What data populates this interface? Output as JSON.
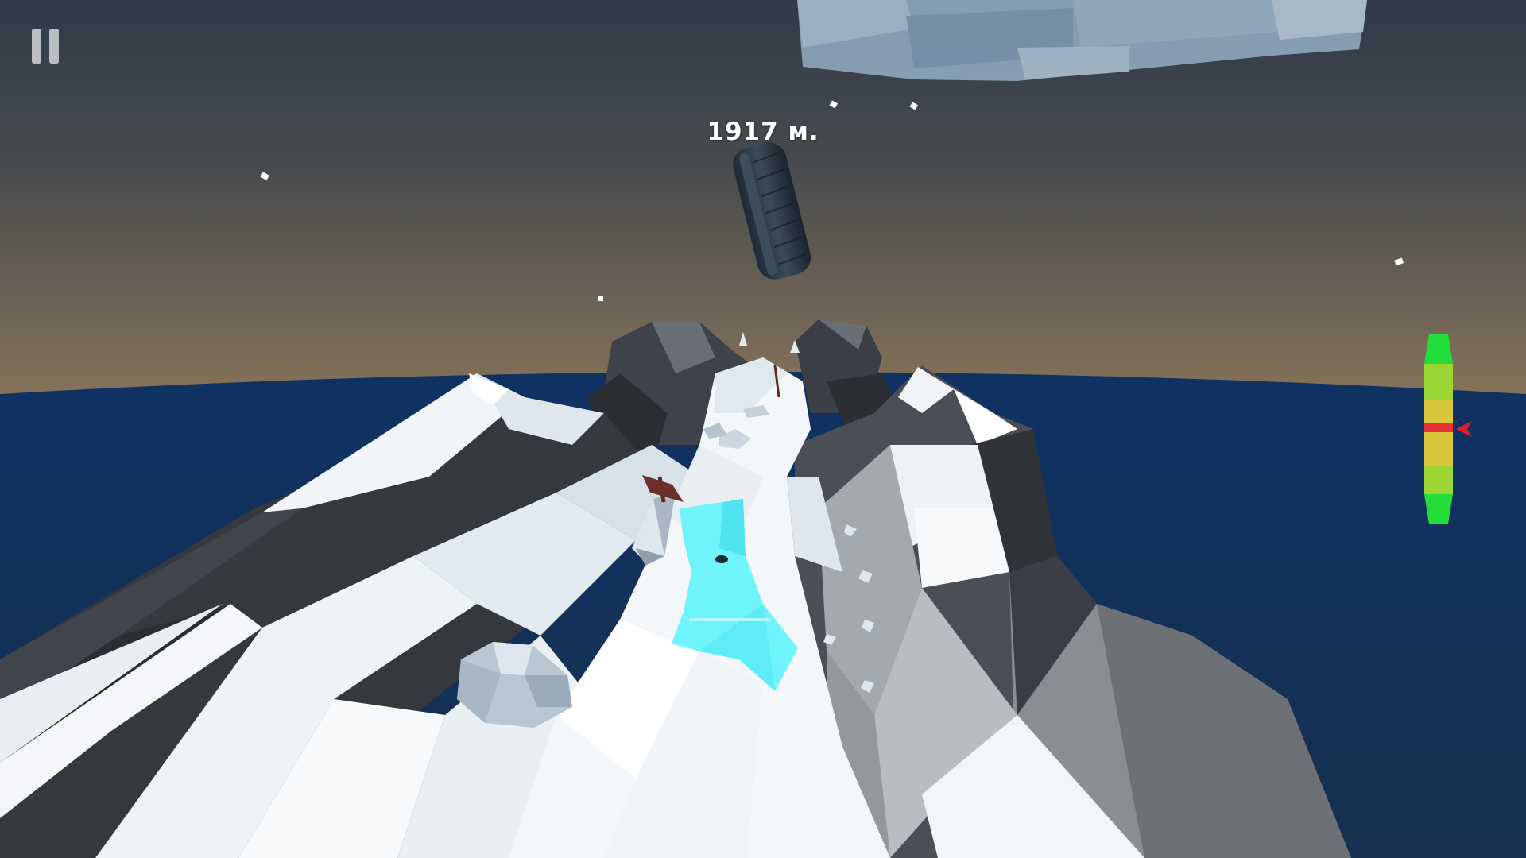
{
  "hud": {
    "distance_label": "1917 м.",
    "pause_icon": "pause-icon",
    "balance_indicator_icon": "arrow-left-icon"
  },
  "balance_meter": {
    "level": 0.5,
    "colors": {
      "safe": "#22dd3a",
      "mid": "#9bd635",
      "caution": "#d9c63b",
      "danger": "#e8303a",
      "pointer": "#e01e2b"
    }
  },
  "scene_colors": {
    "sky_top": "#333e4b",
    "sky_horizon": "#7d6e58",
    "sea": "#102f58",
    "snow": "#f0f4f7",
    "rock_dark": "#2f3338",
    "rock_mid": "#5b5f64",
    "ice": "#6ff4fb"
  }
}
